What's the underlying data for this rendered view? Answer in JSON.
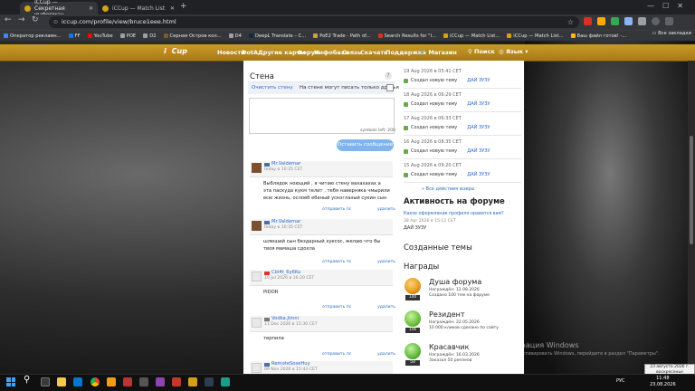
{
  "browser": {
    "tabs": [
      {
        "label": "iCCup — Секретная информац",
        "active": true
      },
      {
        "label": "iCCup — Match List",
        "active": false
      }
    ],
    "new_tab": "+",
    "window_controls": "—☐✕",
    "url": "iccup.com/profile/view/bruce1eee.html",
    "bookmarks": [
      "Оператор рекламн...",
      "FF",
      "YouTube",
      "POE",
      "D2",
      "Серная Остров кол...",
      "D4",
      "DeepL Translate – С...",
      "PoE2 Trade - Path of...",
      "Search Results for \"I...",
      "iCCup — Match List...",
      "iCCup — Match List...",
      "Ваш файл готов! -..."
    ],
    "bookmarks_all": "Все закладки"
  },
  "site": {
    "logo_prefix": "i",
    "logo_o": "C",
    "logo_suffix": "Cup",
    "nav": [
      "Новости",
      "DotA",
      "Другие карты",
      "Форум",
      "Инфобаза",
      "Связь",
      "Скачать",
      "Поддержка",
      "Магазин"
    ],
    "search": "Поиск",
    "lang": "Язык"
  },
  "wall": {
    "title": "Стена",
    "help": "?",
    "clear_wall": "Очистить стену",
    "only_friends": "На стене могут писать только друзья",
    "symbols_left": "symbols left: 200",
    "post_button": "Оставить сообщение",
    "reply_label": "отправить пс",
    "delete_label": "удалить",
    "posts": [
      {
        "author": "Mr.Valdemar",
        "date": "today в 10:35 CET",
        "text": "Выблядок ноющий , я читаю стену вахахахах а эта паскуда кукм телит , тебя наверняка чмырили всю жизнь, ослоеб ебаный ускоглазый сукин сын"
      },
      {
        "author": "Mr.Valdemar",
        "date": "today в 10:35 CET",
        "text": "шлюший сын бездарный хуесос, желаю что бы твоя мамаша сдохла"
      },
      {
        "author": "Cbl4t_6y6Ku",
        "date": "10 Jul 2026 в 16:20 CET",
        "text": "PIDOR"
      },
      {
        "author": "Vodka.Jimni",
        "date": "11 Dec 2026 в 15:30 CET",
        "text": "терпила"
      },
      {
        "author": "RemoteSoseHuy",
        "date": "09 Nov 2026 в 15:43 CET",
        "text": ""
      }
    ]
  },
  "activity": {
    "entries": [
      {
        "date": "19 Aug 2026 в 05:41 CET",
        "action": "Создал новую тему",
        "target": "ДАЙ ЗУЗУ"
      },
      {
        "date": "18 Aug 2026 в 06:29 CET",
        "action": "Создал новую тему",
        "target": "ДАЙ ЗУЗУ"
      },
      {
        "date": "17 Aug 2026 в 06:33 CET",
        "action": "Создал новую тему",
        "target": "ДАЙ ЗУЗУ"
      },
      {
        "date": "16 Aug 2026 в 08:35 CET",
        "action": "Создал новую тему",
        "target": "ДАЙ ЗУЗУ"
      },
      {
        "date": "15 Aug 2026 в 09:20 CET",
        "action": "Создал новую тему",
        "target": "ДАЙ ЗУЗУ"
      }
    ],
    "all_actions": "» Все действия юзера"
  },
  "forum": {
    "title": "Активность на форуме",
    "link": "Какое оформление профиля нравится вам?",
    "date": "28 Apr 2026 в 15:12 CET",
    "user": "ДАЙ ЗУЗУ"
  },
  "topics_title": "Созданные темы",
  "awards": {
    "title": "Награды",
    "items": [
      {
        "name": "Душа форума",
        "line1": "Награждён: 12.08.2026",
        "line2": "Создано 100 тем на форуме",
        "count": "100",
        "color": "#e39a1c"
      },
      {
        "name": "Резидент",
        "line1": "Награждён: 22.05.2026",
        "line2": "10 000 кликов сделано по сайту",
        "count": "10k",
        "color": "#6cc03a"
      },
      {
        "name": "Красавчик",
        "line1": "Награждён: 16.03.2026",
        "line2": "Заказал 50 реплеев",
        "count": "50",
        "color": "#5cb83a"
      }
    ]
  },
  "activation": {
    "title": "Активация Windows",
    "sub": "Чтобы активировать Windows, перейдите в раздел \"Параметры\"."
  },
  "taskbar": {
    "tray": "РУС",
    "time": "11:48",
    "date": "23.08.2026",
    "tooltip": "23 августа 2026 г. воскресенье"
  }
}
